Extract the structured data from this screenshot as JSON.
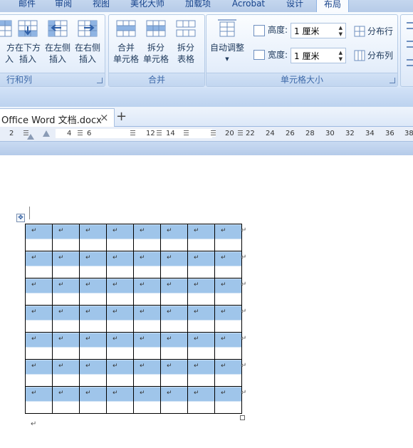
{
  "tabs": [
    "邮件",
    "审阅",
    "视图",
    "美化大师",
    "加载项",
    "Acrobat",
    "设计",
    "布局"
  ],
  "active_tab": "布局",
  "ribbon": {
    "rows_cols_group": {
      "label": "行和列",
      "buttons": [
        {
          "line1": "方",
          "line2": "入"
        },
        {
          "line1": "在下方",
          "line2": "插入"
        },
        {
          "line1": "在左侧",
          "line2": "插入"
        },
        {
          "line1": "在右侧",
          "line2": "插入"
        }
      ]
    },
    "merge_group": {
      "label": "合并",
      "buttons": [
        {
          "line1": "合并",
          "line2": "单元格"
        },
        {
          "line1": "拆分",
          "line2": "单元格"
        },
        {
          "line1": "拆分",
          "line2": "表格"
        }
      ]
    },
    "cell_size_group": {
      "label": "单元格大小",
      "autofit_label": "自动调整",
      "height_label": "高度:",
      "height_value": "1 厘米",
      "width_label": "宽度:",
      "width_value": "1 厘米",
      "distribute_rows": "分布行",
      "distribute_cols": "分布列"
    }
  },
  "document_tab": {
    "title": "Office Word 文档.docx",
    "close_glyph": "×",
    "new_tab_glyph": "+"
  },
  "ruler": {
    "numbers": [
      "2",
      "4",
      "6",
      "12",
      "14",
      "20",
      "22",
      "24",
      "26",
      "28",
      "30",
      "32",
      "34",
      "36",
      "38"
    ]
  },
  "table": {
    "rows": 7,
    "cols": 8,
    "cell_mark": "↵",
    "row_end_mark": "↵",
    "highlight_color": "#9fc5ea"
  },
  "paragraph_mark": "↵"
}
